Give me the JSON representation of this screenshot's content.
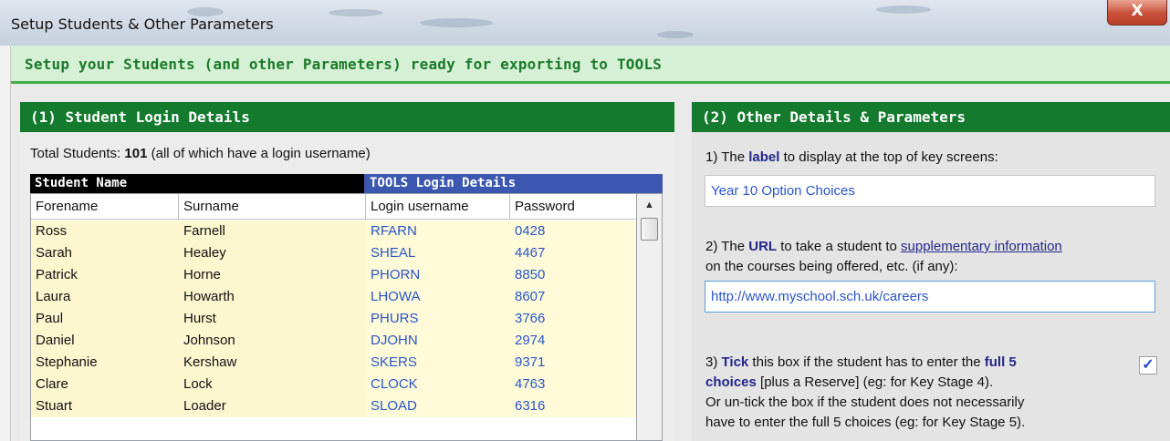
{
  "window": {
    "title": "Setup Students & Other Parameters",
    "close_glyph": "X"
  },
  "header": {
    "text": "Setup your Students (and other Parameters) ready for exporting to TOOLS"
  },
  "left_panel": {
    "title": "(1) Student Login Details",
    "total_prefix": "Total Students: ",
    "total_count": "101",
    "total_suffix": " (all of which have a login username)",
    "group_student": "Student Name",
    "group_tools": "TOOLS Login Details",
    "columns": [
      "Forename",
      "Surname",
      "Login username",
      "Password"
    ],
    "rows": [
      [
        "Ross",
        "Farnell",
        "RFARN",
        "0428"
      ],
      [
        "Sarah",
        "Healey",
        "SHEAL",
        "4467"
      ],
      [
        "Patrick",
        "Horne",
        "PHORN",
        "8850"
      ],
      [
        "Laura",
        "Howarth",
        "LHOWA",
        "8607"
      ],
      [
        "Paul",
        "Hurst",
        "PHURS",
        "3766"
      ],
      [
        "Daniel",
        "Johnson",
        "DJOHN",
        "2974"
      ],
      [
        "Stephanie",
        "Kershaw",
        "SKERS",
        "9371"
      ],
      [
        "Clare",
        "Lock",
        "CLOCK",
        "4763"
      ],
      [
        "Stuart",
        "Loader",
        "SLOAD",
        "6316"
      ]
    ],
    "scroll_up_glyph": "▲"
  },
  "right_panel": {
    "title": "(2) Other Details & Parameters",
    "q1_prefix": "1) The ",
    "q1_bold": "label",
    "q1_suffix": " to display at the top of key screens:",
    "q1_value": "Year 10 Option Choices",
    "q2_prefix": "2) The ",
    "q2_bold": "URL",
    "q2_mid": " to take a student to ",
    "q2_link": "supplementary information",
    "q2_line2": "on the courses being offered, etc. (if any):",
    "q2_value": "http://www.myschool.sch.uk/careers",
    "q3_prefix": "3) ",
    "q3_bold1": "Tick",
    "q3_mid": " this box if the student has to enter the ",
    "q3_bold2": "full 5",
    "q3_bold3": "choices",
    "q3_line2_rest": " [plus a Reserve] (eg: for Key Stage 4).",
    "q3_line3": "Or un-tick the box if the student does not necessarily",
    "q3_line4": "have to enter the full 5 choices (eg: for Key Stage 5).",
    "q3_checked": true,
    "check_glyph": "✓"
  }
}
